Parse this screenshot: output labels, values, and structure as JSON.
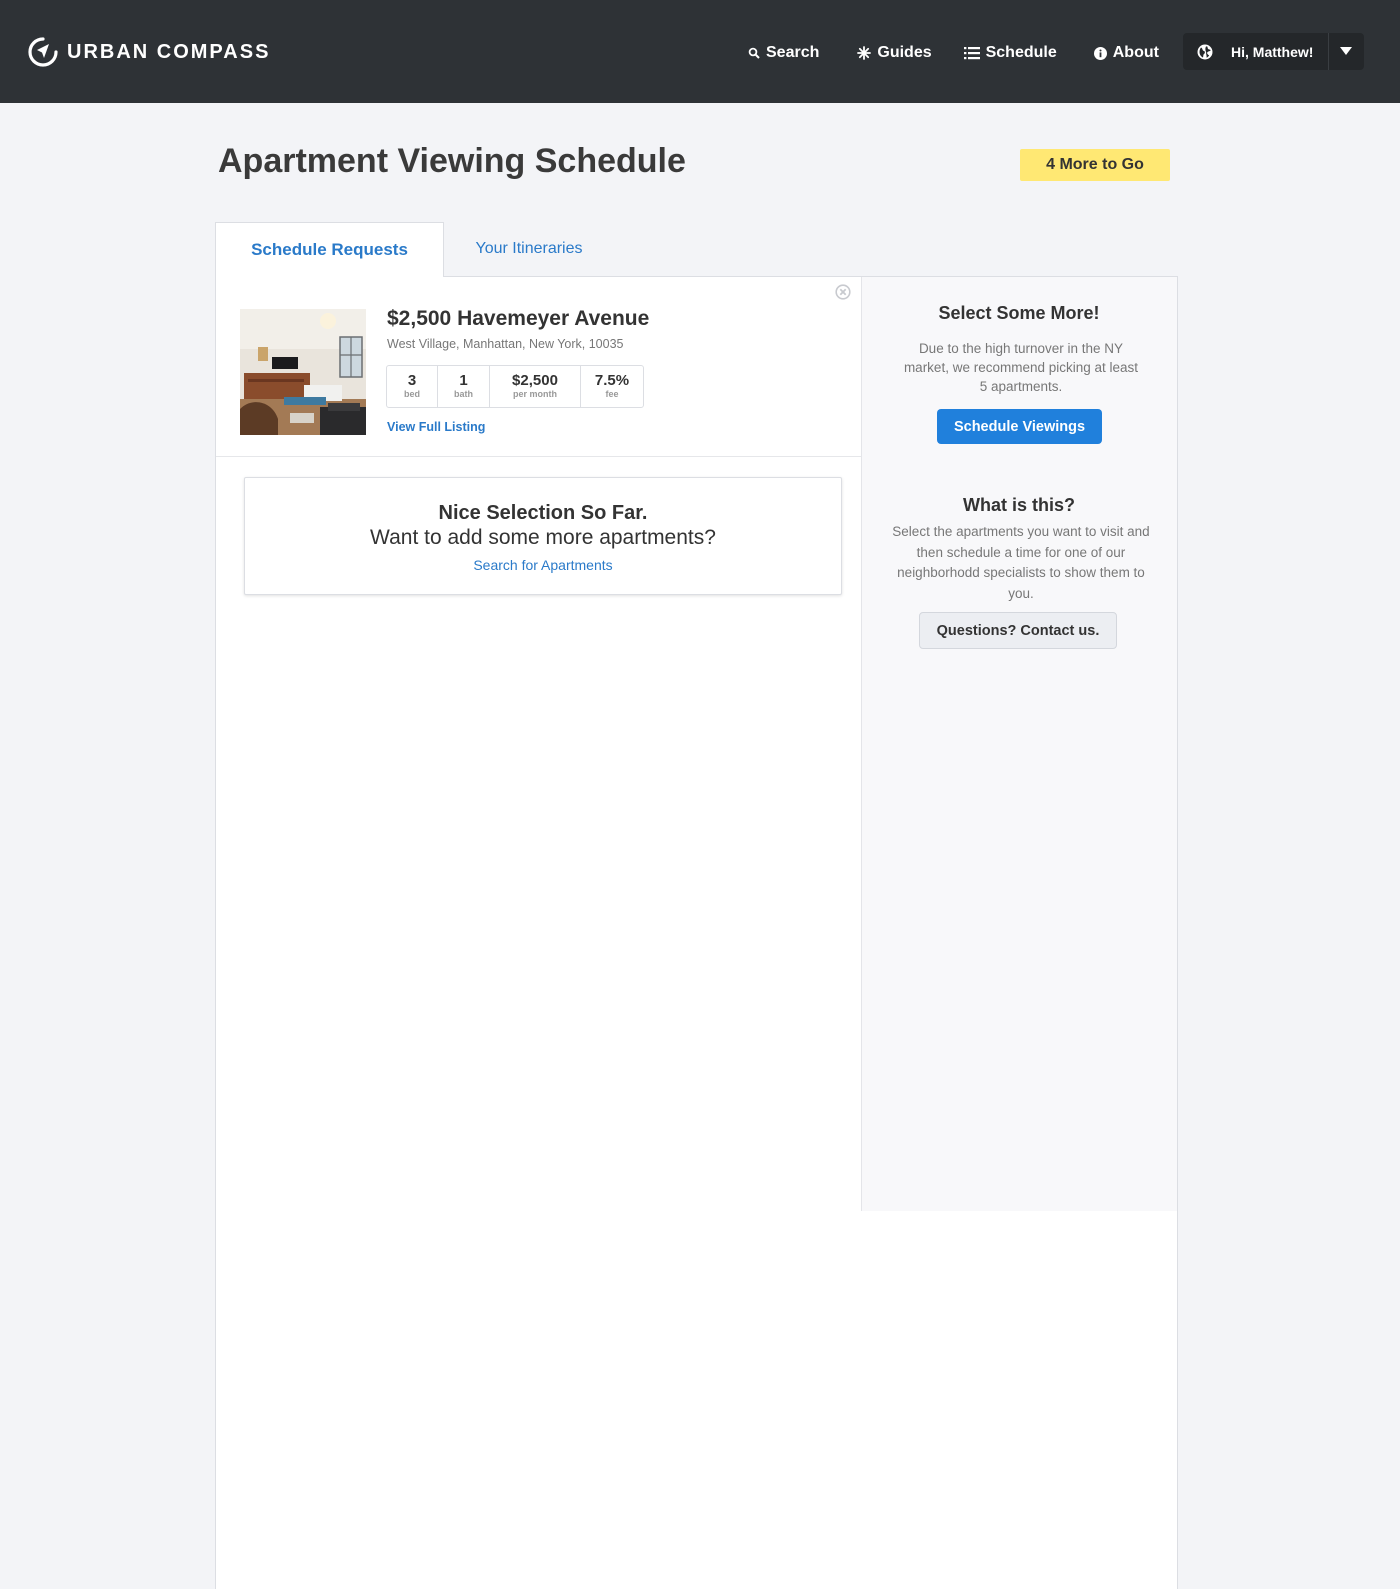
{
  "header": {
    "brand": "URBAN COMPASS",
    "nav": [
      {
        "label": "Search",
        "icon": "search-icon"
      },
      {
        "label": "Guides",
        "icon": "star-icon"
      },
      {
        "label": "Schedule",
        "icon": "list-icon"
      },
      {
        "label": "About",
        "icon": "info-icon"
      }
    ],
    "user": {
      "greeting": "Hi, Matthew!",
      "icon": "globe-icon"
    }
  },
  "page": {
    "title": "Apartment Viewing Schedule",
    "progress_badge": "4 More to Go"
  },
  "tabs": [
    {
      "label": "Schedule Requests",
      "active": true
    },
    {
      "label": "Your Itineraries",
      "active": false
    }
  ],
  "listing": {
    "title": "$2,500 Havemeyer Avenue",
    "address": "West Village, Manhattan, New York, 10035",
    "stats": [
      {
        "value": "3",
        "label": "bed"
      },
      {
        "value": "1",
        "label": "bath"
      },
      {
        "value": "$2,500",
        "label": "per month"
      },
      {
        "value": "7.5%",
        "label": "fee"
      }
    ],
    "link": "View Full Listing"
  },
  "selection": {
    "heading": "Nice Selection So Far.",
    "subheading": "Want to add some more apartments?",
    "link": "Search for Apartments"
  },
  "sidebar": {
    "select_more": {
      "heading": "Select Some More!",
      "text": "Due to the high turnover in the NY market, we recommend picking at least 5 apartments.",
      "button": "Schedule Viewings"
    },
    "what_is_this": {
      "heading": "What is this?",
      "text": "Select the apartments you want to visit and then schedule a time for one of our neighborhodd specialists to show them to you.",
      "button": "Questions? Contact us."
    }
  },
  "colors": {
    "header_bg": "#2e3236",
    "accent_blue": "#2080dc",
    "link_blue": "#2a7ac9",
    "badge_yellow": "#ffe873"
  }
}
